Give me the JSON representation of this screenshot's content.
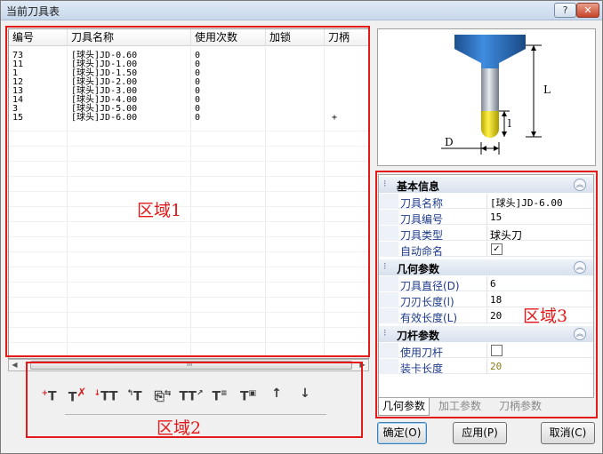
{
  "window": {
    "title": "当前刀具表",
    "help_label": "?",
    "close_label": "✕"
  },
  "table": {
    "columns": [
      "编号",
      "刀具名称",
      "使用次数",
      "加锁",
      "刀柄"
    ],
    "rows": [
      {
        "id": "73",
        "name": "[球头]JD-0.60",
        "uses": "0",
        "lock": "",
        "holder": ""
      },
      {
        "id": "11",
        "name": "[球头]JD-1.00",
        "uses": "0",
        "lock": "",
        "holder": ""
      },
      {
        "id": "1",
        "name": "[球头]JD-1.50",
        "uses": "0",
        "lock": "",
        "holder": ""
      },
      {
        "id": "12",
        "name": "[球头]JD-2.00",
        "uses": "0",
        "lock": "",
        "holder": ""
      },
      {
        "id": "13",
        "name": "[球头]JD-3.00",
        "uses": "0",
        "lock": "",
        "holder": ""
      },
      {
        "id": "14",
        "name": "[球头]JD-4.00",
        "uses": "0",
        "lock": "",
        "holder": ""
      },
      {
        "id": "3",
        "name": "[球头]JD-5.00",
        "uses": "0",
        "lock": "",
        "holder": ""
      },
      {
        "id": "15",
        "name": "[球头]JD-6.00",
        "uses": "0",
        "lock": "",
        "holder": "+"
      }
    ],
    "scroll_grip": "III"
  },
  "toolbar": {
    "icons": [
      "add-tool-icon",
      "delete-tool-icon",
      "insert-tool-icon",
      "import-tool-icon",
      "copy-tool-icon",
      "edit-tool-icon",
      "tool-list-icon",
      "save-tool-icon",
      "move-up-icon",
      "move-down-icon"
    ]
  },
  "regions": {
    "r1": "区域1",
    "r2": "区域2",
    "r3": "区域3",
    "color": "#e41a1a"
  },
  "diagram": {
    "label_L": "L",
    "label_l": "l",
    "label_D": "D"
  },
  "properties": {
    "basic": {
      "title": "基本信息",
      "name_label": "刀具名称",
      "name_value": "[球头]JD-6.00",
      "number_label": "刀具编号",
      "number_value": "15",
      "type_label": "刀具类型",
      "type_value": "球头刀",
      "autoname_label": "自动命名",
      "autoname_checked": "✓"
    },
    "geometry": {
      "title": "几何参数",
      "diameter_label": "刀具直径(D)",
      "diameter_value": "6",
      "edge_label": "刀刃长度(l)",
      "edge_value": "18",
      "effective_label": "有效长度(L)",
      "effective_value": "20"
    },
    "shank": {
      "title": "刀杆参数",
      "use_shank_label": "使用刀杆",
      "clamp_label": "装卡长度",
      "clamp_value": "20"
    }
  },
  "tabs": [
    "几何参数",
    "加工参数",
    "刀柄参数"
  ],
  "buttons": {
    "ok": "确定(O)",
    "apply": "应用(P)",
    "cancel": "取消(C)"
  }
}
